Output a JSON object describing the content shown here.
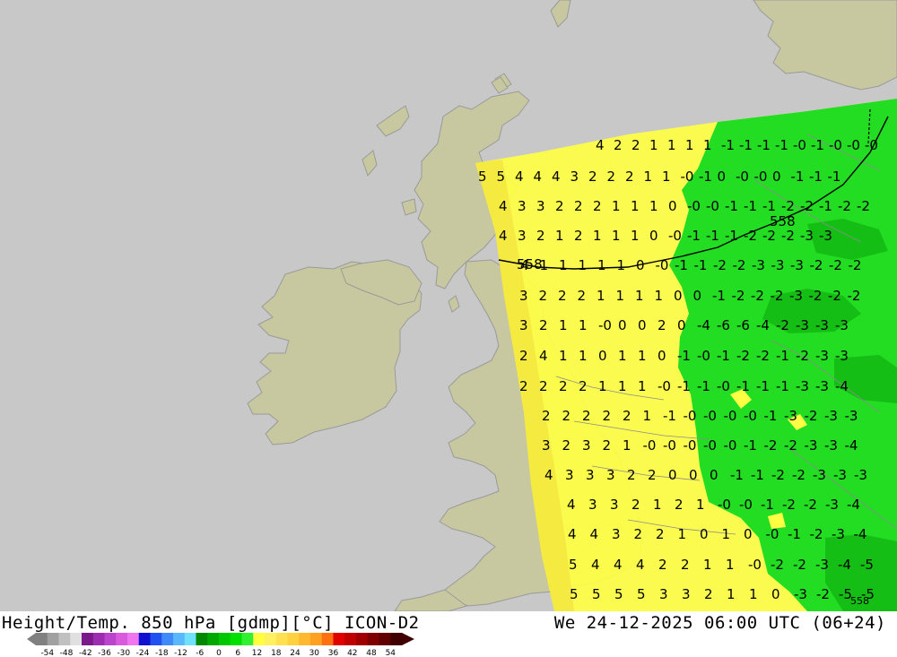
{
  "header": {
    "title": "Height/Temp. 850 hPa [gdmp][°C] ICON-D2",
    "datetime": "We 24-12-2025 06:00 UTC (06+24)"
  },
  "colors": {
    "background": "#c8c8c8",
    "land": "#c8c8a0",
    "coast": "#9a9a9a",
    "warm_field": "#ffff44",
    "warm_field_dark": "#f7e840",
    "cold_field": "#22dd22",
    "cold_field_dark": "#12b812"
  },
  "legend": {
    "ticks": [
      "-54",
      "-48",
      "-42",
      "-36",
      "-30",
      "-24",
      "-18",
      "-12",
      "-6",
      "0",
      "6",
      "12",
      "18",
      "24",
      "30",
      "36",
      "42",
      "48",
      "54"
    ],
    "colors": [
      "#808080",
      "#a0a0a0",
      "#c0c0c0",
      "#e0e0e0",
      "#7a1a8a",
      "#9c2db0",
      "#bb44cc",
      "#d95bdd",
      "#f076f0",
      "#1010d0",
      "#2050f0",
      "#3f8af8",
      "#58b8fb",
      "#70e0fc",
      "#008800",
      "#00a800",
      "#00c800",
      "#00e000",
      "#30f030",
      "#ffff40",
      "#fff060",
      "#ffe050",
      "#ffd040",
      "#ffb830",
      "#ffa020",
      "#ff7010",
      "#e00000",
      "#c00000",
      "#a00000",
      "#800000",
      "#600000",
      "#400000"
    ]
  },
  "contour_labels": [
    "558",
    "558",
    "558"
  ],
  "value_rows": [
    {
      "values": [
        "4",
        "2",
        "2",
        "1",
        "1",
        "1",
        "1",
        "-1",
        "-1",
        "-1",
        "-1",
        "-0",
        "-1",
        "-0",
        "-0",
        "-0"
      ]
    },
    {
      "values": [
        "5",
        "5",
        "4",
        "4",
        "4",
        "3",
        "2",
        "2",
        "2",
        "1",
        "1",
        "-0",
        "-1",
        "0",
        "-0",
        "-0",
        "0",
        "-1",
        "-1",
        "-1"
      ]
    },
    {
      "values": [
        "4",
        "3",
        "3",
        "2",
        "2",
        "2",
        "1",
        "1",
        "1",
        "0",
        "-0",
        "-0",
        "-1",
        "-1",
        "-1",
        "-2",
        "-2",
        "-1",
        "-2",
        "-2"
      ]
    },
    {
      "values": [
        "4",
        "3",
        "2",
        "1",
        "2",
        "1",
        "1",
        "1",
        "0",
        "-0",
        "-1",
        "-1",
        "-1",
        "-2",
        "-2",
        "-2",
        "-3",
        "-3"
      ]
    },
    {
      "values": [
        "4",
        "1",
        "1",
        "1",
        "1",
        "1",
        "0",
        "-0",
        "-1",
        "-1",
        "-2",
        "-2",
        "-3",
        "-3",
        "-3",
        "-2",
        "-2",
        "-2"
      ]
    },
    {
      "values": [
        "3",
        "2",
        "2",
        "2",
        "1",
        "1",
        "1",
        "1",
        "0",
        "0",
        "-1",
        "-2",
        "-2",
        "-2",
        "-3",
        "-2",
        "-2",
        "-2"
      ]
    },
    {
      "values": [
        "3",
        "2",
        "1",
        "1",
        "-0",
        "0",
        "0",
        "2",
        "0",
        "-4",
        "-6",
        "-6",
        "-4",
        "-2",
        "-3",
        "-3",
        "-3"
      ]
    },
    {
      "values": [
        "2",
        "4",
        "1",
        "1",
        "0",
        "1",
        "1",
        "0",
        "-1",
        "-0",
        "-1",
        "-2",
        "-2",
        "-1",
        "-2",
        "-3",
        "-3"
      ]
    },
    {
      "values": [
        "2",
        "2",
        "2",
        "2",
        "1",
        "1",
        "1",
        "-0",
        "-1",
        "-1",
        "-0",
        "-1",
        "-1",
        "-1",
        "-3",
        "-3",
        "-4"
      ]
    },
    {
      "values": [
        "2",
        "2",
        "2",
        "2",
        "2",
        "1",
        "-1",
        "-0",
        "-0",
        "-0",
        "-0",
        "-1",
        "-3",
        "-2",
        "-3",
        "-3"
      ]
    },
    {
      "values": [
        "3",
        "2",
        "3",
        "2",
        "1",
        "-0",
        "-0",
        "-0",
        "-0",
        "-0",
        "-1",
        "-2",
        "-2",
        "-3",
        "-3",
        "-4"
      ]
    },
    {
      "values": [
        "4",
        "3",
        "3",
        "3",
        "2",
        "2",
        "0",
        "0",
        "0",
        "-1",
        "-1",
        "-2",
        "-2",
        "-3",
        "-3",
        "-3"
      ]
    },
    {
      "values": [
        "4",
        "3",
        "3",
        "2",
        "1",
        "2",
        "1",
        "-0",
        "-0",
        "-1",
        "-2",
        "-2",
        "-3",
        "-4"
      ]
    },
    {
      "values": [
        "4",
        "4",
        "3",
        "2",
        "2",
        "1",
        "0",
        "1",
        "0",
        "-0",
        "-1",
        "-2",
        "-3",
        "-4"
      ]
    },
    {
      "values": [
        "5",
        "4",
        "4",
        "4",
        "2",
        "2",
        "1",
        "1",
        "-0",
        "-2",
        "-2",
        "-3",
        "-4",
        "-5"
      ]
    },
    {
      "values": [
        "5",
        "5",
        "5",
        "5",
        "3",
        "3",
        "2",
        "1",
        "1",
        "0",
        "-3",
        "-2",
        "-5",
        "-5"
      ]
    }
  ]
}
